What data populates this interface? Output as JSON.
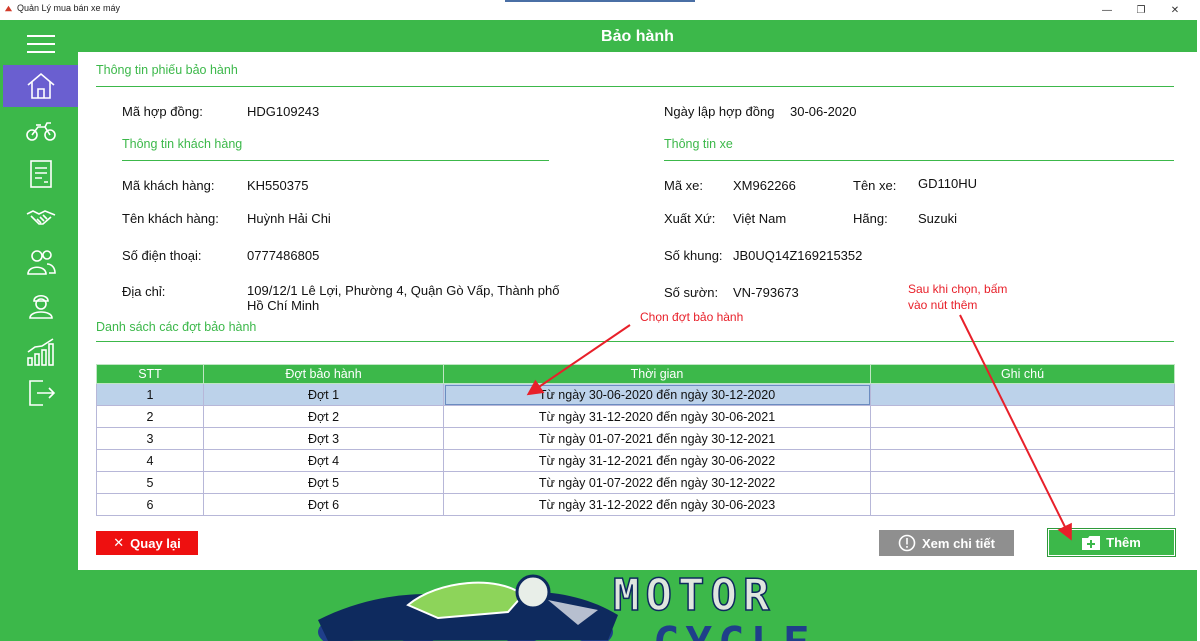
{
  "window": {
    "title": "Quản Lý mua bán xe máy",
    "minimize_glyph": "—",
    "maximize_glyph": "❐",
    "close_glyph": "✕"
  },
  "header": {
    "title": "Bảo hành"
  },
  "sidebar": {
    "items": [
      {
        "icon": "menu-icon"
      },
      {
        "icon": "home-icon",
        "active": true
      },
      {
        "icon": "motorbike-icon"
      },
      {
        "icon": "invoice-icon"
      },
      {
        "icon": "handshake-icon"
      },
      {
        "icon": "customers-icon"
      },
      {
        "icon": "employee-icon"
      },
      {
        "icon": "statistics-icon"
      },
      {
        "icon": "logout-icon"
      }
    ]
  },
  "form": {
    "section_title": "Thông tin phiếu bảo hành",
    "contract": {
      "label": "Mã hợp đồng:",
      "value": "HDG109243"
    },
    "contract_date": {
      "label": "Ngày lập hợp đồng",
      "value": "30-06-2020"
    },
    "customer": {
      "title": "Thông tin khách hàng",
      "id_label": "Mã khách hàng:",
      "id_value": "KH550375",
      "name_label": "Tên khách hàng:",
      "name_value": "Huỳnh Hải Chi",
      "phone_label": "Số điện thoại:",
      "phone_value": "0777486805",
      "address_label": "Địa chỉ:",
      "address_line1": "109/12/1 Lê Lợi, Phường 4, Quận Gò Vấp, Thành phố",
      "address_line2": "Hồ Chí Minh"
    },
    "vehicle": {
      "title": "Thông tin xe",
      "id_label": "Mã xe:",
      "id_value": "XM962266",
      "name_label": "Tên xe:",
      "name_value": "GD110HU",
      "origin_label": "Xuất Xứ:",
      "origin_value": "Việt Nam",
      "brand_label": "Hãng:",
      "brand_value": "Suzuki",
      "frame_label": "Số khung:",
      "frame_value": "JB0UQ14Z169215352",
      "engine_label": "Số sườn:",
      "engine_value": "VN-793673"
    }
  },
  "list": {
    "title": "Danh sách các đợt bảo hành",
    "columns": [
      "STT",
      "Đợt bảo hành",
      "Thời gian",
      "Ghi chú"
    ],
    "rows": [
      [
        "1",
        "Đợt 1",
        "Từ ngày 30-06-2020 đến ngày 30-12-2020",
        ""
      ],
      [
        "2",
        "Đợt 2",
        "Từ ngày 31-12-2020 đến ngày 30-06-2021",
        ""
      ],
      [
        "3",
        "Đợt 3",
        "Từ ngày 01-07-2021 đến ngày 30-12-2021",
        ""
      ],
      [
        "4",
        "Đợt 4",
        "Từ ngày 31-12-2021 đến ngày 30-06-2022",
        ""
      ],
      [
        "5",
        "Đợt 5",
        "Từ ngày 01-07-2022 đến ngày 30-12-2022",
        ""
      ],
      [
        "6",
        "Đợt 6",
        "Từ ngày 31-12-2022 đến ngày 30-06-2023",
        ""
      ]
    ],
    "selected_row": 1
  },
  "buttons": {
    "back": "Quay lại",
    "back_glyph": "✕",
    "detail": "Xem chi tiết",
    "add": "Thêm"
  },
  "annotations": {
    "select": "Chọn đợt bảo hành",
    "add_line1": "Sau khi chọn, bấm",
    "add_line2": "vào nút thêm"
  },
  "banner": {
    "line1": "MOTOR",
    "line2": "CYCLE"
  },
  "colors": {
    "primary": "#3cb84a",
    "active_nav": "#6a5fd0",
    "danger": "#ee1010",
    "neutral": "#8f8f8f",
    "selected_row": "#bcd2ea",
    "annotation": "#e8202a"
  }
}
